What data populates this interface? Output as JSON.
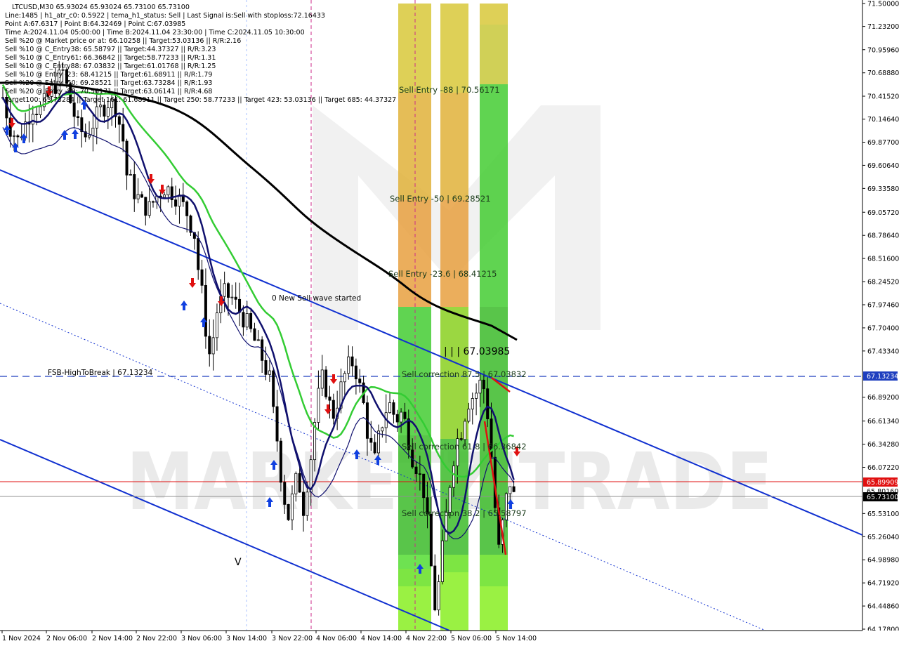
{
  "header": {
    "lines": [
      "LTCUSD,M30  65.93024 65.93024 65.73100 65.73100",
      "Line:1485  | h1_atr_c0: 0.5922  | tema_h1_status: Sell  | Last Signal is:Sell with stoploss:72.16433",
      "Point A:67.6317  | Point B:64.32469  | Point C:67.03985",
      "Time A:2024.11.04 05:00:00  | Time B:2024.11.04 23:30:00  | Time C:2024.11.05 10:30:00",
      "Sell %20 @ Market price or at: 66.10258  || Target:53.03136  || R/R:2.16",
      "Sell %10 @ C_Entry38: 65.58797  || Target:44.37327  || R/R:3.23",
      "Sell %10 @ C_Entry61: 66.36842  || Target:58.77233  || R/R:1.31",
      "Sell %10 @ C_Entry88: 67.03832  || Target:61.01768  || R/R:1.25",
      "Sell %10 @ Entry -23: 68.41215  || Target:61.68911  || R/R:1.79",
      "Sell %20 @ Entry -50: 69.28521  || Target:63.73284  || R/R:1.93",
      "Sell %20 @ Entry -88: 70.56171  || Target:63.06141  || R/R:4.68",
      "Target100: 63.73284  || Target 161: 61.68911  || Target 250: 58.77233  || Target 423: 53.03136  || Target 685: 44.37327"
    ]
  },
  "watermark": "MARKETZITRADE",
  "annotations": {
    "fsb_label": "FSB-HighToBreak | 67.13234",
    "wave_label": "0 New Sell wave started",
    "point_c_label": "| | | 67.03985",
    "v_label": "V",
    "sell_entry_88": "Sell Entry -88 | 70.56171",
    "sell_entry_50": "Sell Entry -50 | 69.28521",
    "sell_entry_23": "Sell Entry -23.6 | 68.41215",
    "sell_corr_87": "Sell correction 87.5 | 67.03832",
    "sell_corr_61": "Sell correction 61.8 | 66.36842",
    "sell_corr_38": "Sell correction 38.2 | 65.58797"
  },
  "price_tags": {
    "fsb": {
      "text": "67.13234",
      "color": "#1f3fbf"
    },
    "red": {
      "text": "65.89909",
      "color": "#e01010"
    },
    "bid": {
      "text": "65.73100",
      "color": "#000000"
    },
    "extra": {
      "text": "65.80160"
    }
  },
  "colors": {
    "bull_candle": "#000000",
    "channel": "#1030d0",
    "ema_green": "#33cc33",
    "ema_navy": "#10106e",
    "sma_black": "#000000",
    "zone_yellow": "#d8c83a",
    "zone_orange": "#e8a040",
    "zone_green": "#44cc33",
    "zone_lime": "#88ee22",
    "signal_red": "#e01010",
    "signal_blue": "#1040e0"
  },
  "chart_data": {
    "type": "line",
    "symbol": "LTCUSD",
    "timeframe": "M30",
    "y_ticks": [
      "71.50000",
      "71.23200",
      "70.95960",
      "70.68880",
      "70.41520",
      "70.14640",
      "69.87700",
      "69.60640",
      "69.33580",
      "69.05720",
      "68.78640",
      "68.51600",
      "68.24520",
      "67.97460",
      "67.70400",
      "67.43340",
      "67.13234",
      "66.89200",
      "66.61340",
      "66.34280",
      "66.07220",
      "65.89909",
      "65.80160",
      "65.73100",
      "65.53100",
      "65.26040",
      "64.98980",
      "64.71920",
      "64.44860",
      "64.17800"
    ],
    "ylim": [
      64.178,
      71.5
    ],
    "x_ticks": [
      "1 Nov 2024",
      "2 Nov 06:00",
      "2 Nov 14:00",
      "2 Nov 22:00",
      "3 Nov 06:00",
      "3 Nov 14:00",
      "3 Nov 22:00",
      "4 Nov 06:00",
      "4 Nov 14:00",
      "4 Nov 22:00",
      "5 Nov 06:00",
      "5 Nov 14:00"
    ],
    "levels": [
      {
        "name": "FSB-HighToBreak",
        "value": 67.13234
      },
      {
        "name": "Sell Entry -88",
        "value": 70.56171
      },
      {
        "name": "Sell Entry -50",
        "value": 69.28521
      },
      {
        "name": "Sell Entry -23.6",
        "value": 68.41215
      },
      {
        "name": "Sell correction 87.5",
        "value": 67.03832
      },
      {
        "name": "Sell correction 61.8",
        "value": 66.36842
      },
      {
        "name": "Sell correction 38.2",
        "value": 65.58797
      },
      {
        "name": "Point C",
        "value": 67.03985
      }
    ],
    "close_series": [
      [
        0,
        70.4
      ],
      [
        2,
        70.05
      ],
      [
        4,
        69.9
      ],
      [
        6,
        70.1
      ],
      [
        8,
        70.3
      ],
      [
        10,
        70.25
      ],
      [
        12,
        70.4
      ],
      [
        14,
        70.55
      ],
      [
        16,
        70.7
      ],
      [
        18,
        70.35
      ],
      [
        20,
        70.05
      ],
      [
        22,
        69.95
      ],
      [
        24,
        70.1
      ],
      [
        26,
        70.25
      ],
      [
        28,
        70.35
      ],
      [
        30,
        70.3
      ],
      [
        32,
        69.9
      ],
      [
        33,
        69.5
      ],
      [
        35,
        69.3
      ],
      [
        37,
        69.15
      ],
      [
        39,
        69.1
      ],
      [
        41,
        69.25
      ],
      [
        43,
        69.35
      ],
      [
        45,
        69.3
      ],
      [
        47,
        69.2
      ],
      [
        49,
        69.05
      ],
      [
        51,
        68.8
      ],
      [
        52,
        68.4
      ],
      [
        53,
        68.1
      ],
      [
        54,
        67.7
      ],
      [
        55,
        67.4
      ],
      [
        56,
        67.6
      ],
      [
        57,
        67.9
      ],
      [
        59,
        68.1
      ],
      [
        61,
        68.05
      ],
      [
        63,
        67.9
      ],
      [
        65,
        67.75
      ],
      [
        67,
        67.55
      ],
      [
        69,
        67.35
      ],
      [
        71,
        67.1
      ],
      [
        72,
        66.7
      ],
      [
        73,
        66.4
      ],
      [
        74,
        66.0
      ],
      [
        75,
        65.7
      ],
      [
        76,
        65.5
      ],
      [
        77,
        65.7
      ],
      [
        78,
        65.9
      ],
      [
        79,
        65.85
      ],
      [
        80,
        65.6
      ],
      [
        81,
        65.9
      ],
      [
        82,
        66.2
      ],
      [
        83,
        66.6
      ],
      [
        84,
        66.9
      ],
      [
        85,
        67.1
      ],
      [
        86,
        67.0
      ],
      [
        87,
        66.8
      ],
      [
        88,
        66.7
      ],
      [
        89,
        66.85
      ],
      [
        90,
        67.0
      ],
      [
        91,
        67.15
      ],
      [
        92,
        67.25
      ],
      [
        93,
        67.3
      ],
      [
        94,
        67.2
      ],
      [
        95,
        67.0
      ],
      [
        96,
        66.8
      ],
      [
        97,
        66.5
      ],
      [
        98,
        66.3
      ],
      [
        99,
        66.15
      ],
      [
        100,
        66.4
      ],
      [
        101,
        66.6
      ],
      [
        102,
        66.75
      ],
      [
        103,
        66.8
      ],
      [
        104,
        66.7
      ],
      [
        105,
        66.65
      ],
      [
        106,
        66.7
      ],
      [
        107,
        66.6
      ],
      [
        108,
        66.4
      ],
      [
        109,
        66.2
      ],
      [
        110,
        66.1
      ],
      [
        111,
        65.95
      ],
      [
        112,
        65.8
      ],
      [
        113,
        65.4
      ],
      [
        114,
        64.9
      ],
      [
        115,
        64.45
      ],
      [
        116,
        64.7
      ],
      [
        117,
        65.1
      ],
      [
        118,
        65.5
      ],
      [
        119,
        65.9
      ],
      [
        120,
        66.2
      ],
      [
        121,
        66.4
      ],
      [
        122,
        66.5
      ],
      [
        123,
        66.7
      ],
      [
        124,
        66.85
      ],
      [
        125,
        66.9
      ],
      [
        126,
        66.95
      ],
      [
        127,
        67.05
      ],
      [
        128,
        67.0
      ],
      [
        129,
        66.7
      ],
      [
        130,
        66.2
      ],
      [
        131,
        65.6
      ],
      [
        132,
        65.1
      ],
      [
        133,
        65.4
      ],
      [
        134,
        65.7
      ],
      [
        135,
        65.9
      ],
      [
        136,
        65.73
      ]
    ]
  }
}
